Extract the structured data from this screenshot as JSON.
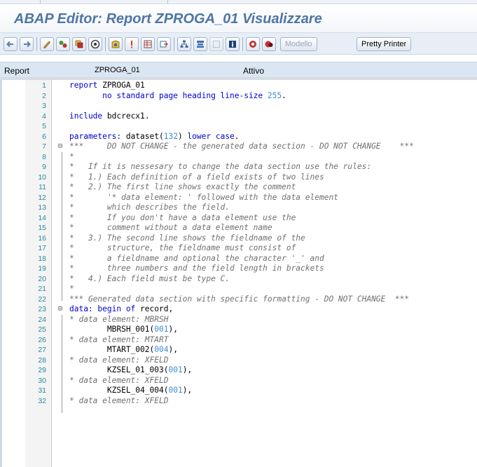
{
  "window": {
    "title": "ABAP Editor: Report ZPROGA_01 Visualizzare"
  },
  "toolbar": {
    "icons": [
      "back-arrow-icon",
      "forward-arrow-icon",
      "display-change-icon",
      "other-object-icon",
      "activate-icon",
      "check-icon",
      "test-icon",
      "where-used-icon",
      "object-list-icon",
      "navigation-window-icon",
      "display-object-list-icon",
      "enhance-icon",
      "breakpoint-icon",
      "block-icon",
      "clipboard-icon",
      "info-icon",
      "pattern-icon",
      "concatenate-icon"
    ],
    "modello_label": "Modello",
    "pretty_printer_label": "Pretty Printer"
  },
  "infobar": {
    "label": "Report",
    "program_name": "ZPROGA_01",
    "status": "Attivo"
  },
  "colors": {
    "title": "#4e76a3",
    "keyword": "#0000d0",
    "number": "#3c8dd0",
    "comment": "#707070",
    "line_number": "#2a8a9a"
  },
  "code_lines": [
    {
      "n": "1",
      "fold": "",
      "segs": [
        {
          "t": "report ",
          "c": "kw"
        },
        {
          "t": "ZPROGA_01",
          "c": ""
        }
      ]
    },
    {
      "n": "2",
      "fold": "",
      "segs": [
        {
          "t": "       no standard page heading line-size ",
          "c": "kw"
        },
        {
          "t": "255",
          "c": "num"
        },
        {
          "t": ".",
          "c": ""
        }
      ]
    },
    {
      "n": "3",
      "fold": "",
      "segs": []
    },
    {
      "n": "4",
      "fold": "",
      "segs": [
        {
          "t": "include ",
          "c": "kw"
        },
        {
          "t": "bdcrecx1.",
          "c": ""
        }
      ]
    },
    {
      "n": "5",
      "fold": "",
      "segs": []
    },
    {
      "n": "6",
      "fold": "",
      "segs": [
        {
          "t": "parameters: ",
          "c": "kw"
        },
        {
          "t": "dataset",
          "c": ""
        },
        {
          "t": "(",
          "c": ""
        },
        {
          "t": "132",
          "c": "num"
        },
        {
          "t": ") ",
          "c": ""
        },
        {
          "t": "lower case",
          "c": "kw"
        },
        {
          "t": ".",
          "c": ""
        }
      ]
    },
    {
      "n": "7",
      "fold": "⊟",
      "segs": [
        {
          "t": "***     DO NOT CHANGE - the generated data section - DO NOT CHANGE    ***",
          "c": "cmt"
        }
      ]
    },
    {
      "n": "8",
      "fold": "",
      "segs": [
        {
          "t": "*",
          "c": "cmt"
        }
      ]
    },
    {
      "n": "9",
      "fold": "",
      "segs": [
        {
          "t": "*   If it is nessesary to change the data section use the rules:",
          "c": "cmt"
        }
      ]
    },
    {
      "n": "10",
      "fold": "",
      "segs": [
        {
          "t": "*   1.) Each definition of a field exists of two lines",
          "c": "cmt"
        }
      ]
    },
    {
      "n": "11",
      "fold": "",
      "segs": [
        {
          "t": "*   2.) The first line shows exactly the comment",
          "c": "cmt"
        }
      ]
    },
    {
      "n": "12",
      "fold": "",
      "segs": [
        {
          "t": "*       '* data element: ' followed with the data element",
          "c": "cmt"
        }
      ]
    },
    {
      "n": "13",
      "fold": "",
      "segs": [
        {
          "t": "*       which describes the field.",
          "c": "cmt"
        }
      ]
    },
    {
      "n": "14",
      "fold": "",
      "segs": [
        {
          "t": "*       If you don't have a data element use the",
          "c": "cmt"
        }
      ]
    },
    {
      "n": "15",
      "fold": "",
      "segs": [
        {
          "t": "*       comment without a data element name",
          "c": "cmt"
        }
      ]
    },
    {
      "n": "16",
      "fold": "",
      "segs": [
        {
          "t": "*   3.) The second line shows the fieldname of the",
          "c": "cmt"
        }
      ]
    },
    {
      "n": "17",
      "fold": "",
      "segs": [
        {
          "t": "*       structure, the fieldname must consist of",
          "c": "cmt"
        }
      ]
    },
    {
      "n": "18",
      "fold": "",
      "segs": [
        {
          "t": "*       a fieldname and optional the character '_' and",
          "c": "cmt"
        }
      ]
    },
    {
      "n": "19",
      "fold": "",
      "segs": [
        {
          "t": "*       three numbers and the field length in brackets",
          "c": "cmt"
        }
      ]
    },
    {
      "n": "20",
      "fold": "",
      "segs": [
        {
          "t": "*   4.) Each field must be type C.",
          "c": "cmt"
        }
      ]
    },
    {
      "n": "21",
      "fold": "",
      "segs": [
        {
          "t": "*",
          "c": "cmt"
        }
      ]
    },
    {
      "n": "22",
      "fold": "",
      "segs": [
        {
          "t": "*** Generated data section with specific formatting - DO NOT CHANGE  ***",
          "c": "cmt"
        }
      ]
    },
    {
      "n": "23",
      "fold": "⊟",
      "segs": [
        {
          "t": "data: begin of ",
          "c": "kw"
        },
        {
          "t": "record,",
          "c": ""
        }
      ]
    },
    {
      "n": "24",
      "fold": "",
      "segs": [
        {
          "t": "* data element: MBRSH",
          "c": "cmt"
        }
      ]
    },
    {
      "n": "25",
      "fold": "",
      "segs": [
        {
          "t": "        MBRSH_001",
          "c": ""
        },
        {
          "t": "(",
          "c": ""
        },
        {
          "t": "001",
          "c": "num"
        },
        {
          "t": "),",
          "c": ""
        }
      ]
    },
    {
      "n": "26",
      "fold": "",
      "segs": [
        {
          "t": "* data element: MTART",
          "c": "cmt"
        }
      ]
    },
    {
      "n": "27",
      "fold": "",
      "segs": [
        {
          "t": "        MTART_002",
          "c": ""
        },
        {
          "t": "(",
          "c": ""
        },
        {
          "t": "004",
          "c": "num"
        },
        {
          "t": "),",
          "c": ""
        }
      ]
    },
    {
      "n": "28",
      "fold": "",
      "segs": [
        {
          "t": "* data element: XFELD",
          "c": "cmt"
        }
      ]
    },
    {
      "n": "29",
      "fold": "",
      "segs": [
        {
          "t": "        KZSEL_01_003",
          "c": ""
        },
        {
          "t": "(",
          "c": ""
        },
        {
          "t": "001",
          "c": "num"
        },
        {
          "t": "),",
          "c": ""
        }
      ]
    },
    {
      "n": "30",
      "fold": "",
      "segs": [
        {
          "t": "* data element: XFELD",
          "c": "cmt"
        }
      ]
    },
    {
      "n": "31",
      "fold": "",
      "segs": [
        {
          "t": "        KZSEL_04_004",
          "c": ""
        },
        {
          "t": "(",
          "c": ""
        },
        {
          "t": "001",
          "c": "num"
        },
        {
          "t": "),",
          "c": ""
        }
      ]
    },
    {
      "n": "32",
      "fold": "",
      "segs": [
        {
          "t": "* data element: XFELD",
          "c": "cmt"
        }
      ]
    }
  ]
}
